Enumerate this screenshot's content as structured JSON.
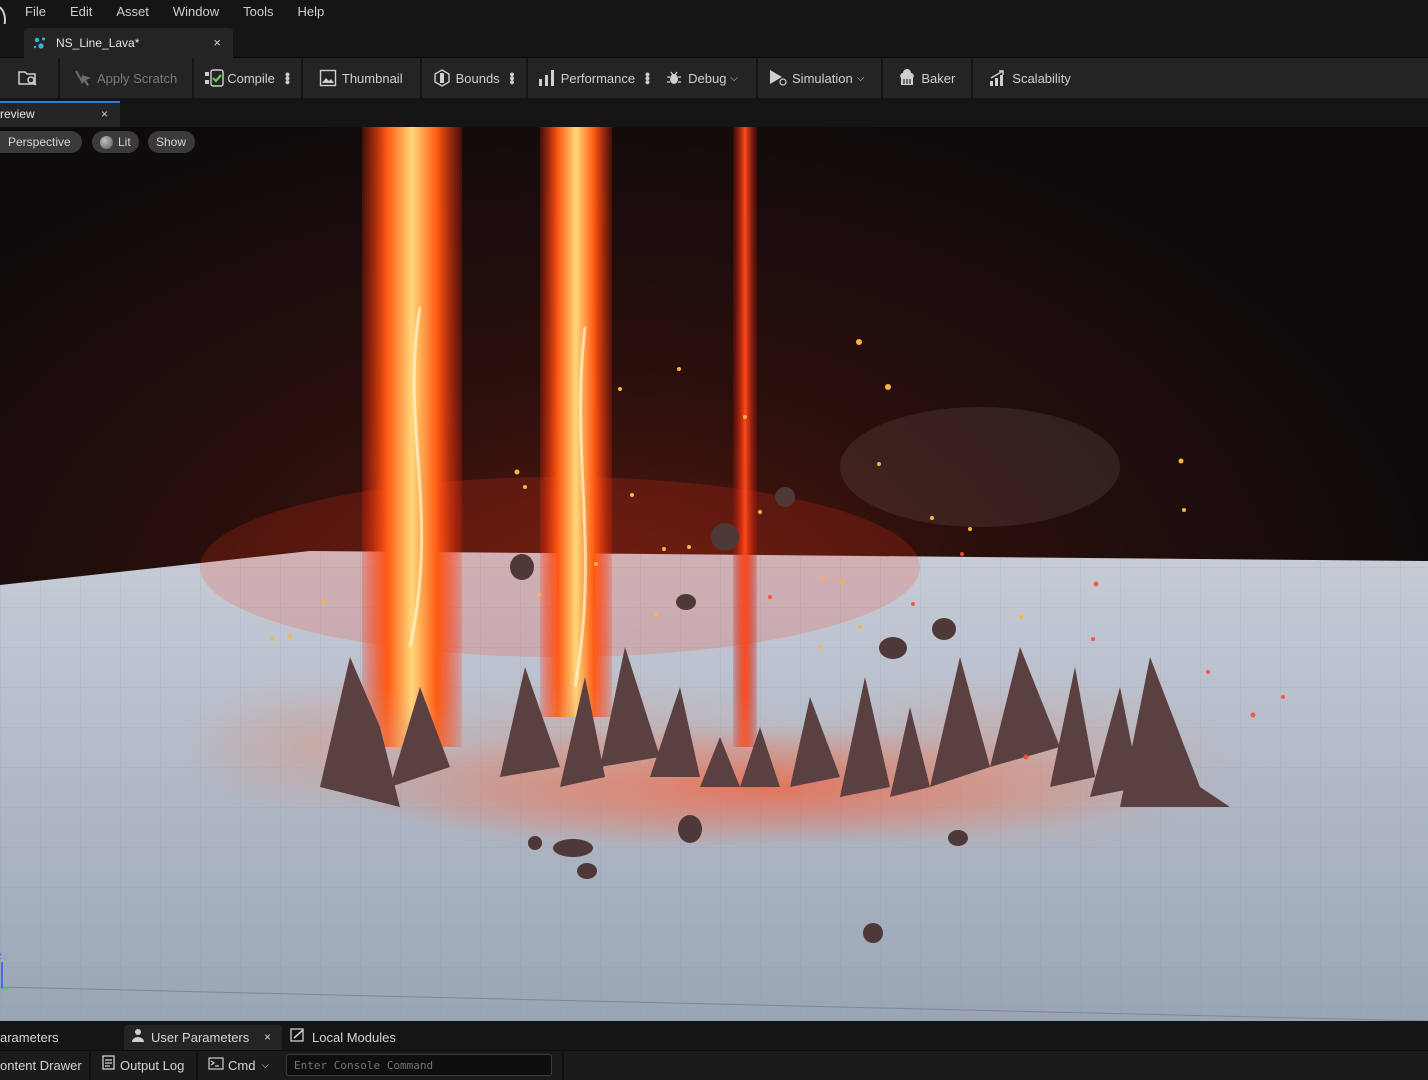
{
  "menu": {
    "items": [
      "File",
      "Edit",
      "Asset",
      "Window",
      "Tools",
      "Help"
    ]
  },
  "document_tab": {
    "title": "NS_Line_Lava*",
    "close": "×"
  },
  "toolbar": {
    "apply_scratch": "Apply Scratch",
    "compile": "Compile",
    "thumbnail": "Thumbnail",
    "bounds": "Bounds",
    "performance": "Performance",
    "debug": "Debug",
    "simulation": "Simulation",
    "baker": "Baker",
    "scalability": "Scalability"
  },
  "preview_tab": {
    "label": "review",
    "close": "×"
  },
  "viewport": {
    "perspective": "Perspective",
    "lit": "Lit",
    "show": "Show",
    "axis_z": "z"
  },
  "bottom_tabs": {
    "parameters": "arameters",
    "user_parameters": "User Parameters",
    "user_parameters_close": "×",
    "local_modules": "Local Modules"
  },
  "statusbar": {
    "content_drawer": "ontent Drawer",
    "output_log": "Output Log",
    "cmd": "Cmd",
    "console_placeholder": "Enter Console Command"
  },
  "colors": {
    "accent": "#2a7fd1",
    "lava_core": "#ffe08a",
    "lava_outer": "#ff3b12",
    "floor": "#aeb9c8"
  }
}
